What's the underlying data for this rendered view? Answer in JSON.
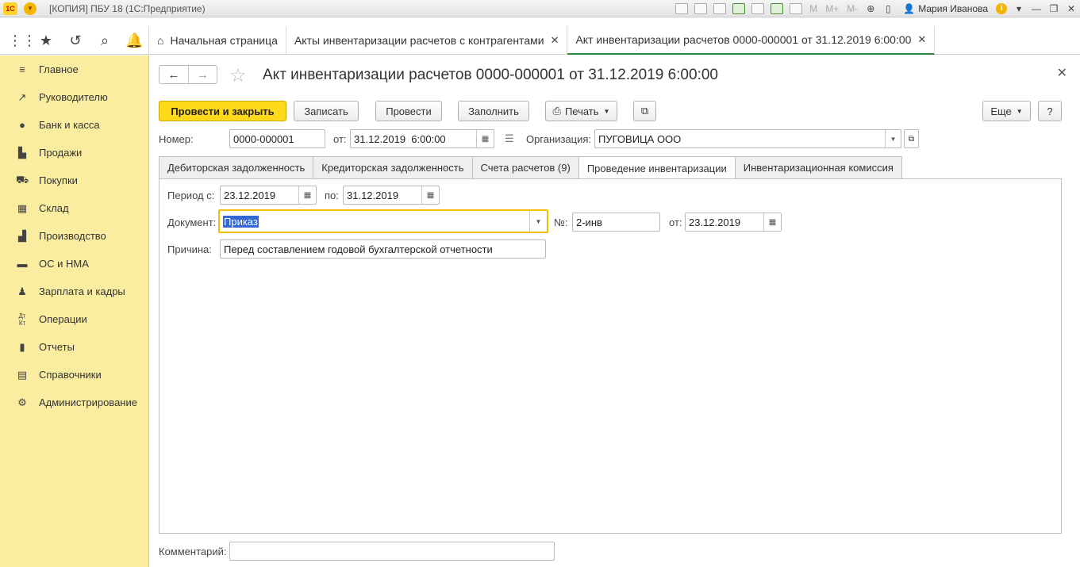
{
  "app": {
    "logo_text": "1С",
    "title": "[КОПИЯ] ПБУ 18  (1С:Предприятие)",
    "toolbar_texts": [
      "M",
      "M+",
      "M-"
    ],
    "user": "Мария Иванова"
  },
  "tabs": [
    {
      "label": "Начальная страница"
    },
    {
      "label": "Акты инвентаризации расчетов с контрагентами"
    },
    {
      "label": "Акт инвентаризации расчетов 0000-000001 от 31.12.2019 6:00:00"
    }
  ],
  "sidebar": {
    "items": [
      {
        "label": "Главное",
        "icon": "menu-icon"
      },
      {
        "label": "Руководителю",
        "icon": "trend-icon"
      },
      {
        "label": "Банк и касса",
        "icon": "coin-icon"
      },
      {
        "label": "Продажи",
        "icon": "cart-sales-icon"
      },
      {
        "label": "Покупки",
        "icon": "cart-icon"
      },
      {
        "label": "Склад",
        "icon": "warehouse-icon"
      },
      {
        "label": "Производство",
        "icon": "factory-icon"
      },
      {
        "label": "ОС и НМА",
        "icon": "truck-icon"
      },
      {
        "label": "Зарплата и кадры",
        "icon": "person-icon"
      },
      {
        "label": "Операции",
        "icon": "dt-kt-icon"
      },
      {
        "label": "Отчеты",
        "icon": "bar-chart-icon"
      },
      {
        "label": "Справочники",
        "icon": "book-icon"
      },
      {
        "label": "Администрирование",
        "icon": "gear-icon"
      }
    ]
  },
  "document": {
    "title": "Акт инвентаризации расчетов 0000-000001 от 31.12.2019 6:00:00"
  },
  "toolbar": {
    "post_close": "Провести и закрыть",
    "save": "Записать",
    "post": "Провести",
    "fill": "Заполнить",
    "print": "Печать",
    "more": "Еще",
    "help": "?"
  },
  "header_fields": {
    "number_label": "Номер:",
    "number_value": "0000-000001",
    "date_label": "от:",
    "date_value": "31.12.2019  6:00:00",
    "org_label": "Организация:",
    "org_value": "ПУГОВИЦА ООО"
  },
  "form_tabs": [
    {
      "label": "Дебиторская задолженность"
    },
    {
      "label": "Кредиторская задолженность"
    },
    {
      "label": "Счета расчетов (9)"
    },
    {
      "label": "Проведение инвентаризации"
    },
    {
      "label": "Инвентаризационная комиссия"
    }
  ],
  "inventory": {
    "period_from_label": "Период с:",
    "period_from": "23.12.2019",
    "period_to_label": "по:",
    "period_to": "31.12.2019",
    "doc_label": "Документ:",
    "doc_value": "Приказ",
    "num_label": "№:",
    "num_value": "2-инв",
    "doc_date_label": "от:",
    "doc_date": "23.12.2019",
    "reason_label": "Причина:",
    "reason_value": "Перед составлением годовой бухгалтерской отчетности"
  },
  "comment": {
    "label": "Комментарий:",
    "value": ""
  }
}
